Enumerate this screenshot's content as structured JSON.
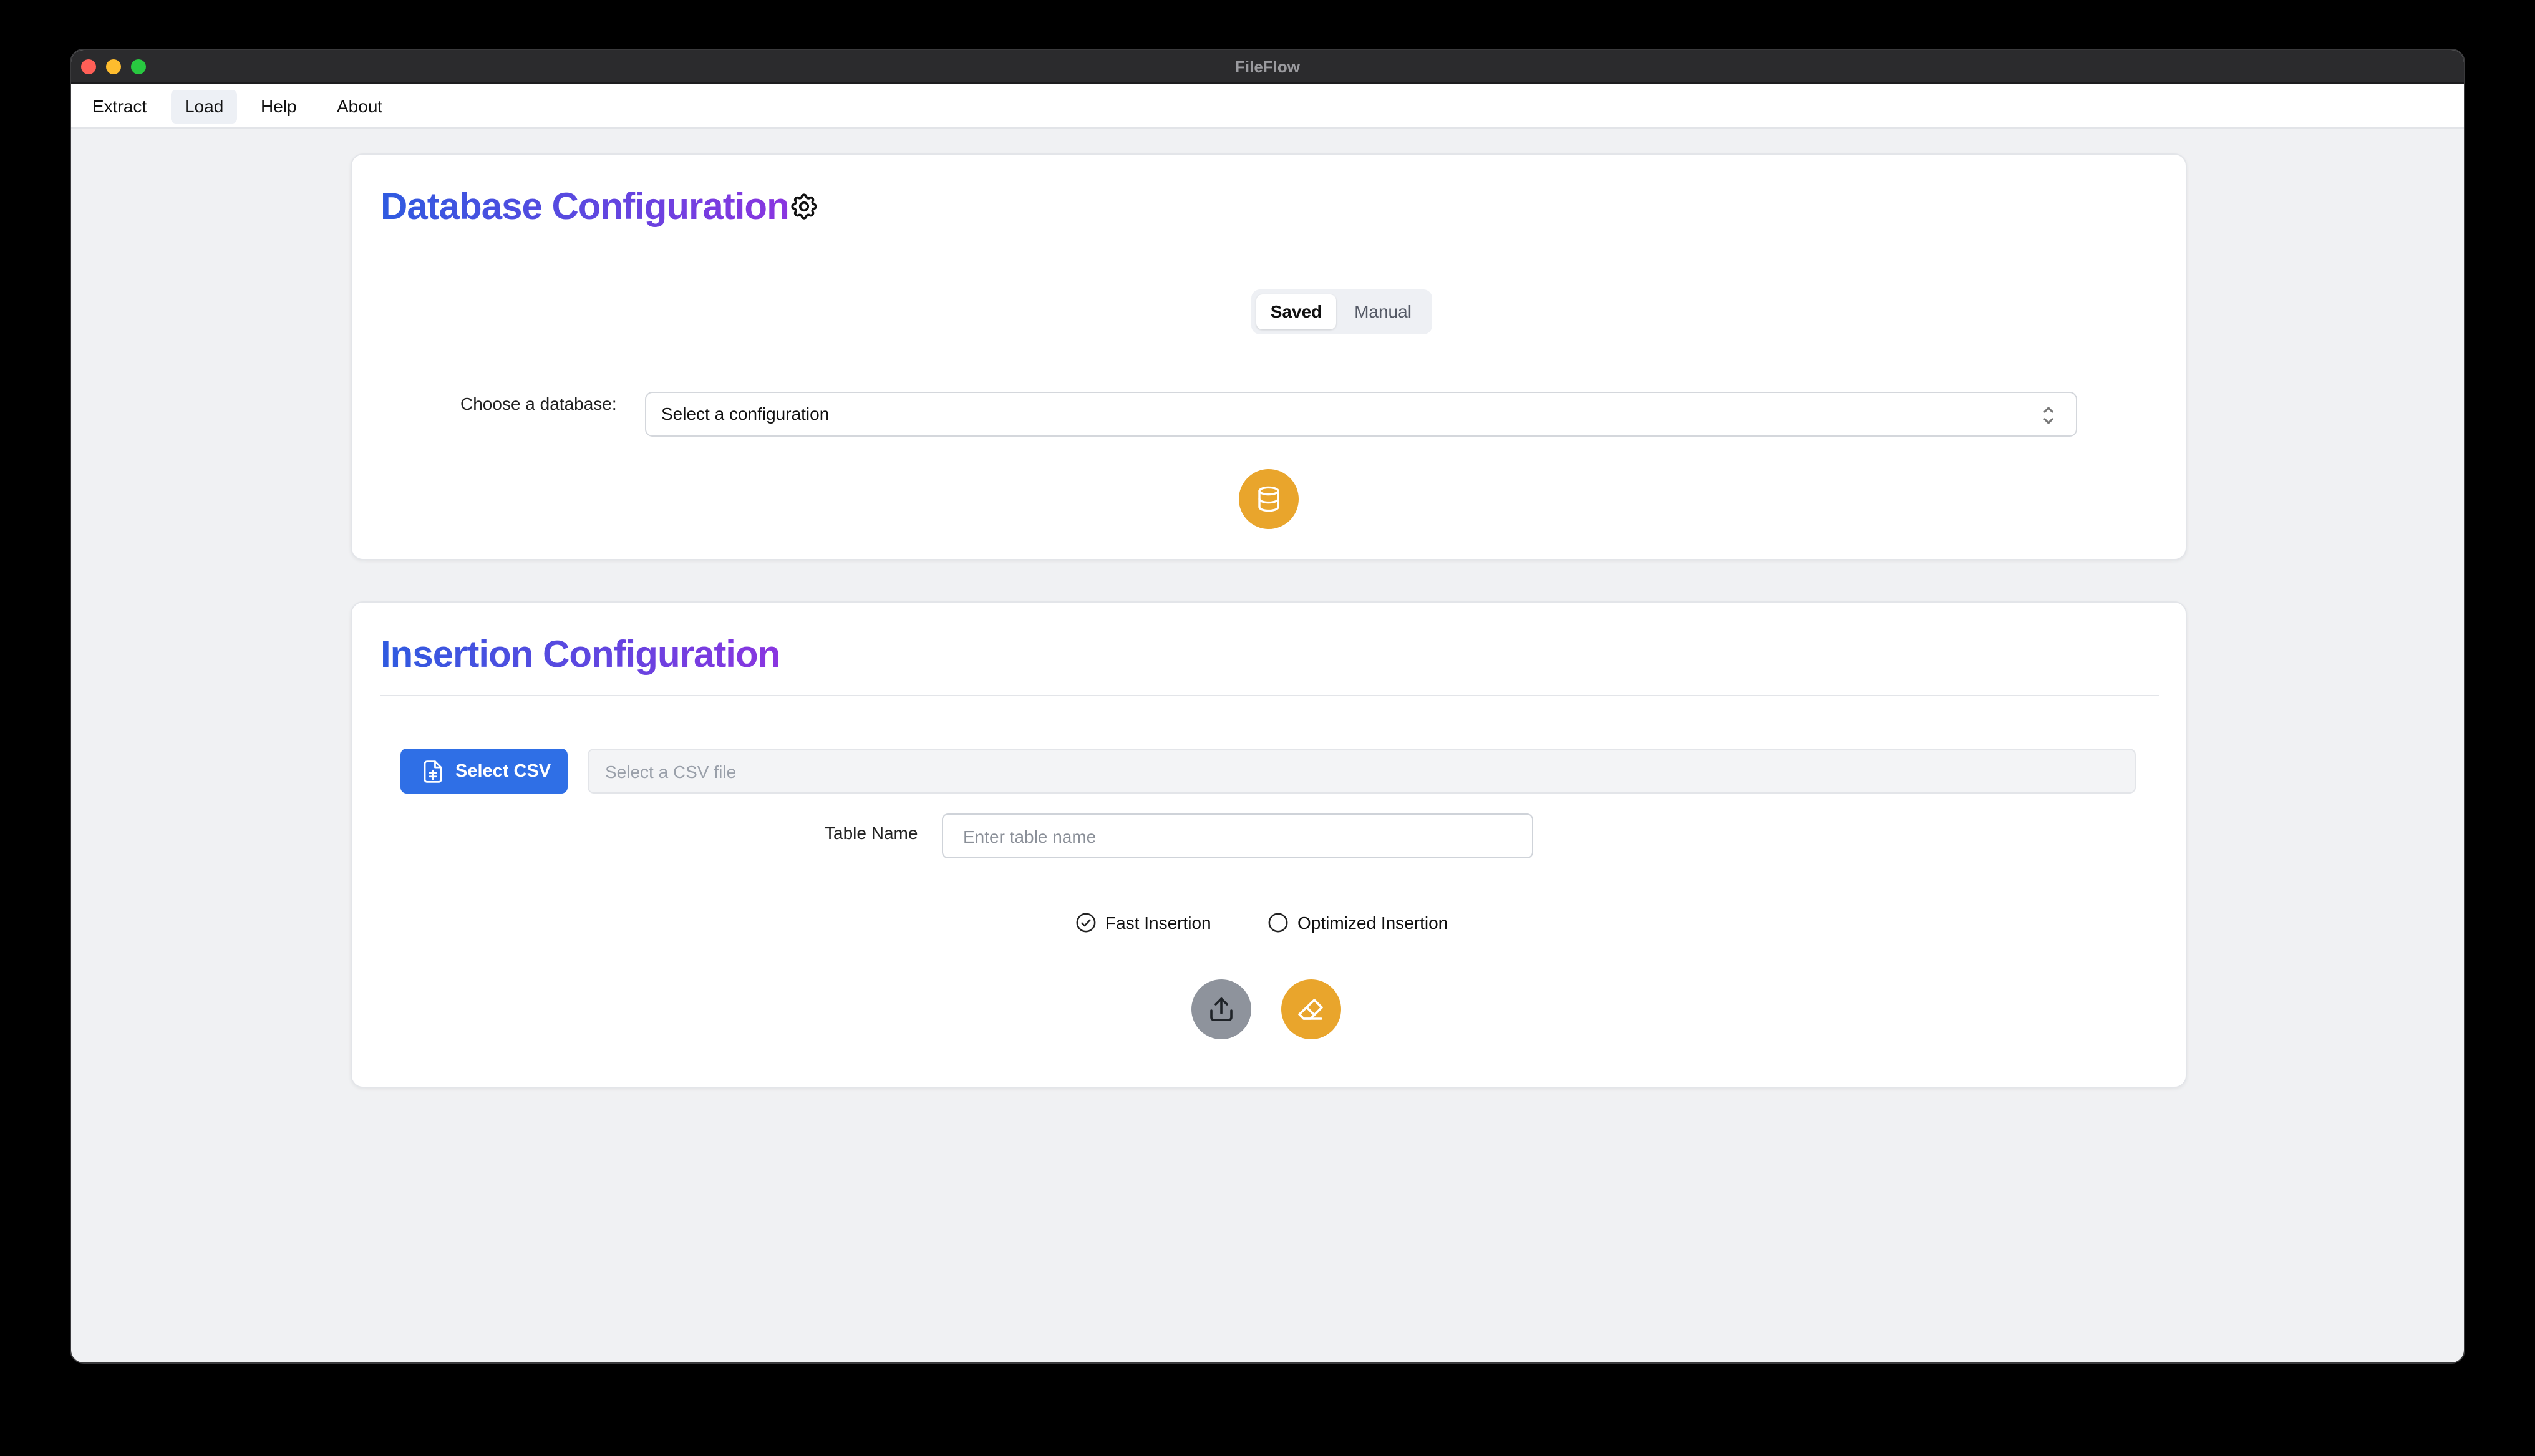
{
  "window": {
    "title": "FileFlow"
  },
  "menu": {
    "items": [
      {
        "label": "Extract"
      },
      {
        "label": "Load"
      },
      {
        "label": "Help"
      },
      {
        "label": "About"
      }
    ],
    "active": "Load"
  },
  "database_config": {
    "heading": "Database Configuration",
    "tabs": {
      "saved": "Saved",
      "manual": "Manual",
      "selected": "Saved"
    },
    "choose_label": "Choose a database:",
    "select_value": "Select a configuration",
    "connect_icon": "database-icon"
  },
  "insertion_config": {
    "heading": "Insertion Configuration",
    "select_csv_label": "Select CSV",
    "csv_placeholder": "Select a CSV file",
    "table_name_label": "Table Name",
    "table_name_placeholder": "Enter table name",
    "options": [
      {
        "label": "Fast Insertion",
        "checked": true
      },
      {
        "label": "Optimized Insertion",
        "checked": false
      }
    ],
    "upload_icon": "upload-icon",
    "clear_icon": "eraser-icon"
  },
  "colors": {
    "accent_blue": "#2f6fe6",
    "accent_orange": "#e9a52c",
    "heading_gradient_start": "#2f5be0",
    "heading_gradient_end": "#8a35e0"
  }
}
